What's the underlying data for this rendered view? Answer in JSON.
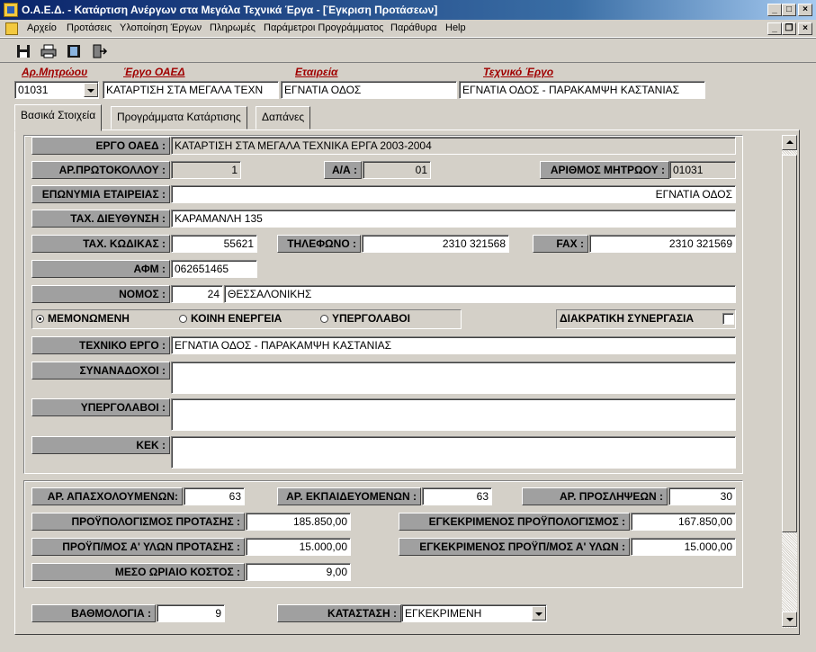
{
  "window": {
    "title": "Ο.Α.Ε.Δ. - Κατάρτιση Ανέργων στα Μεγάλα Τεχνικά Έργα - [Έγκριση Προτάσεων]"
  },
  "menu": [
    "Αρχείο",
    "Προτάσεις",
    "Υλοποίηση Έργων",
    "Πληρωμές",
    "Παράμετροι Προγράμματος",
    "Παράθυρα",
    "Help"
  ],
  "header": {
    "labels": {
      "registry": "Αρ.Μητρώου",
      "oaed_project": "Έργο ΟΑΕΔ",
      "company": "Εταιρεία",
      "tech_project": "Τεχνικό Έργο"
    },
    "values": {
      "registry": "01031",
      "oaed_project": "ΚΑΤΑΡΤΙΣΗ ΣΤΑ ΜΕΓΑΛΑ ΤΕΧΝ",
      "company": "ΕΓΝΑΤΙΑ ΟΔΟΣ",
      "tech_project": "ΕΓΝΑΤΙΑ ΟΔΟΣ - ΠΑΡΑΚΑΜΨΗ ΚΑΣΤΑΝΙΑΣ"
    }
  },
  "tabs": [
    "Βασικά Στοιχεία",
    "Προγράμματα Κατάρτισης",
    "Δαπάνες"
  ],
  "form": {
    "labels": {
      "ergo_oaed": "ΕΡΓΟ ΟΑΕΔ :",
      "ar_protokollou": "ΑΡ.ΠΡΩΤΟΚΟΛΛΟΥ :",
      "aa": "Α/Α :",
      "ar_mitroou": "ΑΡΙΘΜΟΣ ΜΗΤΡΩΟΥ :",
      "eponymia": "ΕΠΩΝΥΜΙΑ ΕΤΑΙΡΕΙΑΣ :",
      "dieythynsi": "ΤΑΧ. ΔΙΕΥΘΥΝΣΗ :",
      "tk": "ΤΑΧ. ΚΩΔΙΚΑΣ :",
      "tilefono": "ΤΗΛΕΦΩΝΟ :",
      "fax": "FAX :",
      "afm": "ΑΦΜ :",
      "nomos": "ΝΟΜΟΣ :",
      "texniko_ergo": "ΤΕΧΝΙΚΟ ΕΡΓΟ :",
      "synanadoxoi": "ΣΥΝΑΝΑΔΟΧΟΙ :",
      "ypergolavoi": "ΥΠΕΡΓΟΛΑΒΟΙ :",
      "kek": "ΚΕΚ :"
    },
    "values": {
      "ergo_oaed": "ΚΑΤΑΡΤΙΣΗ ΣΤΑ ΜΕΓΑΛΑ ΤΕΧΝΙΚΑ ΕΡΓΑ 2003-2004",
      "ar_protokollou": "1",
      "aa": "01",
      "ar_mitroou": "01031",
      "eponymia": "ΕΓΝΑΤΙΑ ΟΔΟΣ",
      "dieythynsi": "ΚΑΡΑΜΑΝΛΗ 135",
      "tk": "55621",
      "tilefono": "2310 321568",
      "fax": "2310 321569",
      "afm": "062651465",
      "nomos_code": "24",
      "nomos_name": "ΘΕΣΣΑΛΟΝΙΚΗΣ",
      "texniko_ergo": "ΕΓΝΑΤΙΑ ΟΔΟΣ - ΠΑΡΑΚΑΜΨΗ ΚΑΣΤΑΝΙΑΣ",
      "synanadoxoi": "",
      "ypergolavoi": "",
      "kek": ""
    },
    "radios": {
      "option1": "ΜΕΜΟΝΩΜΕΝΗ",
      "option2": "ΚΟΙΝΗ ΕΝΕΡΓΕΙΑ",
      "option3": "ΥΠΕΡΓΟΛΑΒΟΙ",
      "selected": "ΜΕΜΟΝΩΜΕΝΗ"
    },
    "checkbox_label": "ΔΙΑΚΡΑΤΙΚΗ ΣΥΝΕΡΓΑΣΙΑ"
  },
  "stats": {
    "labels": {
      "apasxoloumenon": "ΑΡ. ΑΠΑΣΧΟΛΟΥΜΕΝΩΝ:",
      "ekpaideyomenon": "ΑΡ. ΕΚΠΑΙΔΕΥΟΜΕΝΩΝ :",
      "proslipseon": "ΑΡ. ΠΡΟΣΛΗΨΕΩΝ :",
      "proypologismos": "ΠΡΟΫΠΟΛΟΓΙΣΜΟΣ ΠΡΟΤΑΣΗΣ :",
      "egkr_proypologismos": "ΕΓΚΕΚΡΙΜΕΝΟΣ ΠΡΟΫΠΟΛΟΓΙΣΜΟΣ :",
      "proypologismos_ylon": "ΠΡΟΫΠ/ΜΟΣ Α' ΥΛΩΝ ΠΡΟΤΑΣΗΣ :",
      "egkr_ylon": "ΕΓΚΕΚΡΙΜΕΝΟΣ ΠΡΟΫΠ/ΜΟΣ Α' ΥΛΩΝ :",
      "meso_kostos": "ΜΕΣΟ ΩΡΙΑΙΟ ΚΟΣΤΟΣ :"
    },
    "values": {
      "apasxoloumenon": "63",
      "ekpaideyomenon": "63",
      "proslipseon": "30",
      "proypologismos": "185.850,00",
      "egkr_proypologismos": "167.850,00",
      "proypologismos_ylon": "15.000,00",
      "egkr_ylon": "15.000,00",
      "meso_kostos": "9,00"
    }
  },
  "footer": {
    "labels": {
      "vathmologia": "ΒΑΘΜΟΛΟΓΙΑ :",
      "katastasi": "ΚΑΤΑΣΤΑΣΗ :"
    },
    "values": {
      "vathmologia": "9",
      "katastasi": "ΕΓΚΕΚΡΙΜΕΝΗ"
    }
  }
}
